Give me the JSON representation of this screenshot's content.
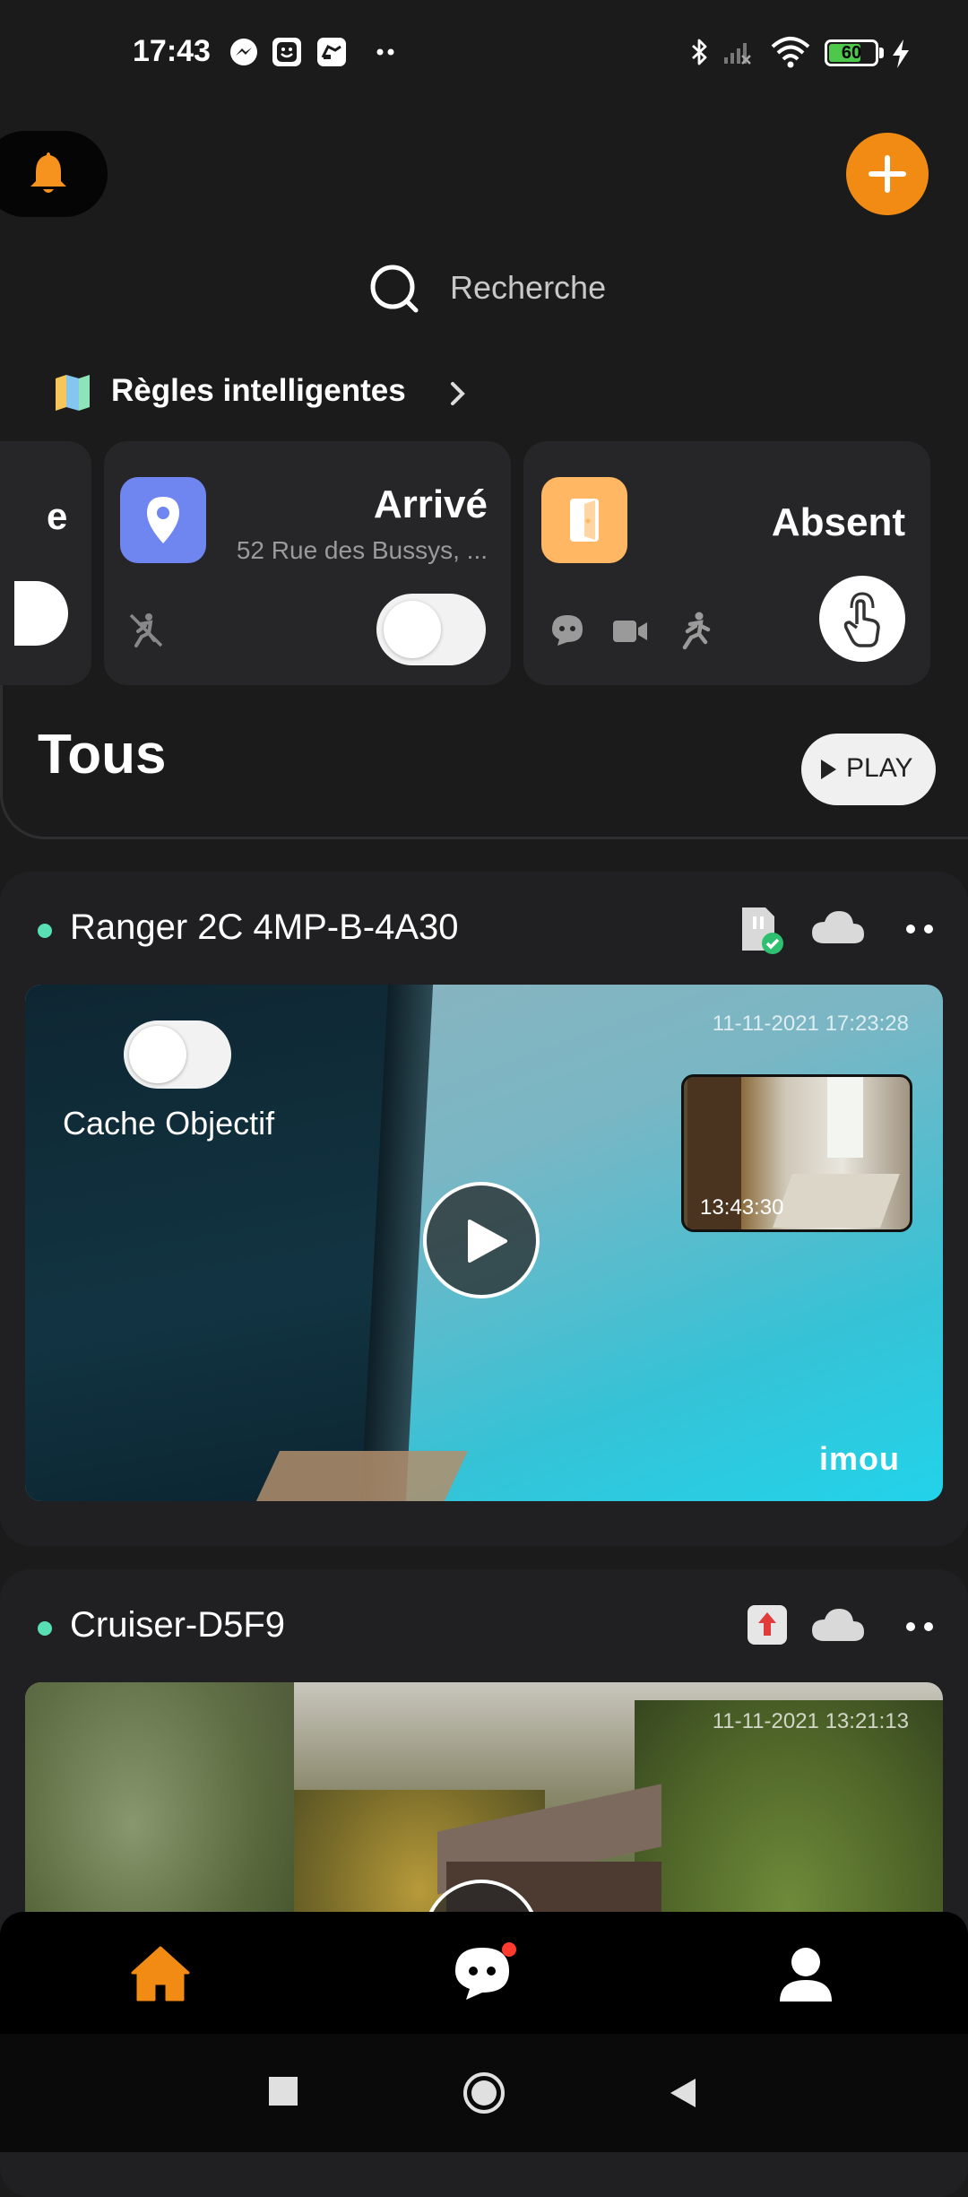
{
  "status_bar": {
    "time": "17:43",
    "battery": "60",
    "icons": [
      "messenger-icon",
      "face-app-icon",
      "cast-app-icon",
      "more-dots-icon",
      "bluetooth-icon",
      "signal-icon",
      "wifi-icon",
      "battery-icon",
      "charging-icon"
    ]
  },
  "header": {
    "search_placeholder": "Recherche"
  },
  "rules": {
    "title": "Règles intelligentes",
    "peek_label": "e",
    "cards": [
      {
        "title": "Arrivé",
        "subtitle": "52 Rue des Bussys, ...",
        "toggle_on": false
      },
      {
        "title": "Absent"
      }
    ]
  },
  "section": {
    "title": "Tous",
    "play_label": "PLAY"
  },
  "devices": [
    {
      "name": "Ranger 2C 4MP-B-4A30",
      "timestamp": "11-11-2021 17:23:28",
      "thumbnail_time": "13:43:30",
      "privacy_label": "Cache Objectif",
      "privacy_on": false,
      "brand": "imou"
    },
    {
      "name": "Cruiser-D5F9",
      "timestamp": "11-11-2021 13:21:13"
    }
  ],
  "colors": {
    "accent": "#f18b13",
    "online_dot": "#58e0b4",
    "arrive_icon_bg": "#6f86f0",
    "absent_icon_bg": "#ffb764",
    "notification_badge": "#ff3b30"
  }
}
